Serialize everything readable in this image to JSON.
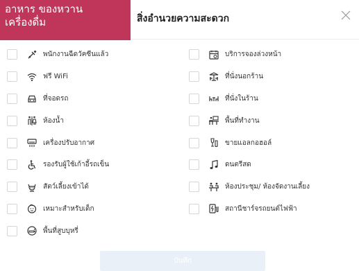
{
  "category_tag": {
    "line1": "อาหาร ของหวาน",
    "line2": "เครื่องดื่ม",
    "color": "#c0365b"
  },
  "modal": {
    "title": "สิ่งอำนวยความสะดวก",
    "close_icon": "close-icon"
  },
  "amenities_left": [
    {
      "label": "พนักงานฉีดวัคซีนแล้ว",
      "icon": "vaccine-icon"
    },
    {
      "label": "ฟรี WiFi",
      "icon": "wifi-icon"
    },
    {
      "label": "ที่จอดรถ",
      "icon": "car-icon"
    },
    {
      "label": "ห้องน้ำ",
      "icon": "restroom-icon"
    },
    {
      "label": "เครื่องปรับอากาศ",
      "icon": "air-conditioner-icon"
    },
    {
      "label": "รองรับผู้ใช้เก้าอี้รถเข็น",
      "icon": "wheelchair-icon"
    },
    {
      "label": "สัตว์เลี้ยงเข้าได้",
      "icon": "pet-icon"
    },
    {
      "label": "เหมาะสำหรับเด็ก",
      "icon": "child-icon"
    },
    {
      "label": "พื้นที่สูบบุหรี่",
      "icon": "smoking-icon"
    }
  ],
  "amenities_right": [
    {
      "label": "บริการจองล่วงหน้า",
      "icon": "reservation-icon"
    },
    {
      "label": "ที่นั่งนอกร้าน",
      "icon": "outdoor-seating-icon"
    },
    {
      "label": "ที่นั่งในร้าน",
      "icon": "indoor-seating-icon"
    },
    {
      "label": "พื้นที่ทำงาน",
      "icon": "workspace-icon"
    },
    {
      "label": "ขายแอลกอฮอล์",
      "icon": "alcohol-icon"
    },
    {
      "label": "ดนตรีสด",
      "icon": "live-music-icon"
    },
    {
      "label": "ห้องประชุม/ ห้องจัดงานเลี้ยง",
      "icon": "meeting-room-icon"
    },
    {
      "label": "สถานีชาร์จรถยนต์ไฟฟ้า",
      "icon": "ev-charger-icon"
    }
  ],
  "submit": {
    "label": "บันทึก"
  }
}
